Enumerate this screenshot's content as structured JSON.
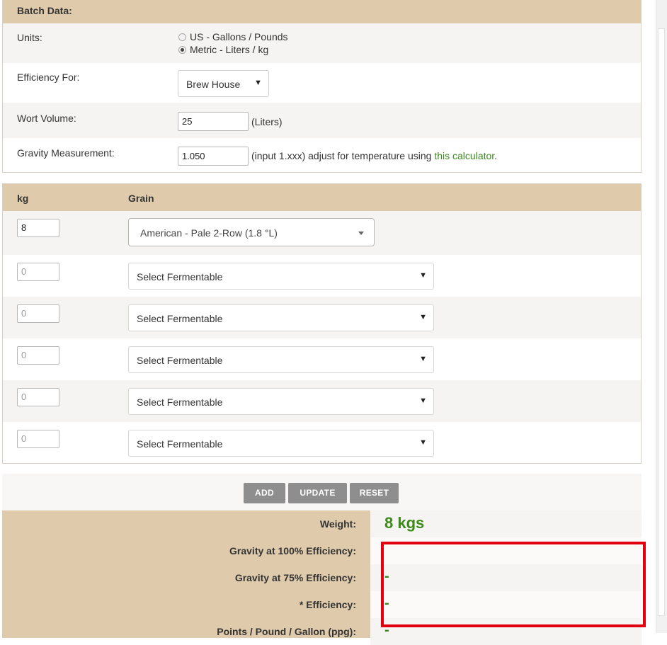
{
  "batch": {
    "title": "Batch Data:",
    "units_label": "Units:",
    "unit_options": [
      "US - Gallons / Pounds",
      "Metric - Liters / kg"
    ],
    "unit_selected": "Metric - Liters / kg",
    "efficiency_label": "Efficiency For:",
    "efficiency_value": "Brew House",
    "wort_label": "Wort Volume:",
    "wort_value": "25",
    "wort_unit": "(Liters)",
    "gravity_label": "Gravity Measurement:",
    "gravity_value": "1.050",
    "gravity_hint": "(input 1.xxx) adjust for temperature using ",
    "gravity_link": "this calculator",
    "gravity_hint_end": "."
  },
  "grain": {
    "col_kg": "kg",
    "col_grain": "Grain",
    "rows": [
      {
        "kg": "8",
        "grain": "American - Pale 2-Row (1.8 °L)"
      },
      {
        "kg": "0",
        "grain": "Select Fermentable"
      },
      {
        "kg": "0",
        "grain": "Select Fermentable"
      },
      {
        "kg": "0",
        "grain": "Select Fermentable"
      },
      {
        "kg": "0",
        "grain": "Select Fermentable"
      },
      {
        "kg": "0",
        "grain": "Select Fermentable"
      }
    ]
  },
  "buttons": {
    "add": "ADD",
    "update": "UPDATE",
    "reset": "RESET"
  },
  "results": {
    "weight_label": "Weight:",
    "weight_value": "8 kgs",
    "gravity100_label": "Gravity at 100% Efficiency:",
    "gravity100_value": "",
    "gravity75_label": "Gravity at 75% Efficiency:",
    "gravity75_value": "-",
    "efficiency_label": "* Efficiency:",
    "efficiency_value": "-",
    "ppg_label": "Points / Pound / Gallon (ppg):",
    "ppg_value": "-"
  },
  "colors": {
    "header_bg": "#dfcbab",
    "accent_green": "#3b8a1a",
    "highlight_red": "#e3000f"
  }
}
